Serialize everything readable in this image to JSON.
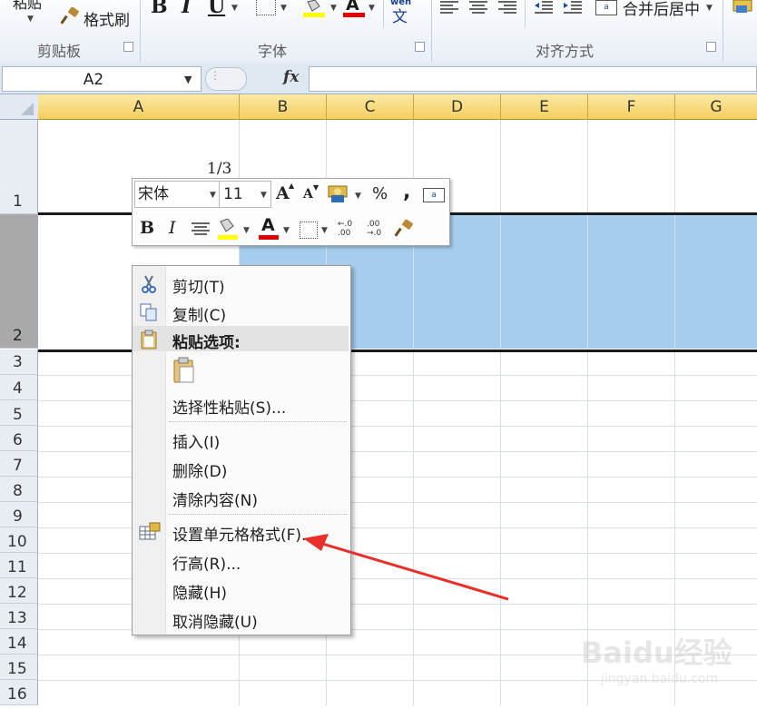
{
  "ribbon": {
    "paste_label": "粘贴",
    "format_painter_label": "格式刷",
    "bold": "B",
    "italic": "I",
    "underline": "U",
    "font_color_glyph": "A",
    "phonetic_glyph": "wén",
    "merge_center_label": "合并后居中",
    "groups": {
      "clipboard": "剪贴板",
      "font": "字体",
      "alignment": "对齐方式"
    }
  },
  "formula_bar": {
    "name_box": "A2",
    "fx_label": "fx",
    "formula": ""
  },
  "grid": {
    "columns": [
      "A",
      "B",
      "C",
      "D",
      "E",
      "F",
      "G"
    ],
    "rows": [
      "1",
      "2",
      "3",
      "4",
      "5",
      "6",
      "7",
      "8",
      "9",
      "10",
      "11",
      "12",
      "13",
      "14",
      "15",
      "16"
    ],
    "selected_row": "2",
    "selection_color": "#a6cdee",
    "cells": {
      "A1": "1/3"
    }
  },
  "mini_toolbar": {
    "font_name": "宋体",
    "font_size": "11",
    "grow_font": "A",
    "shrink_font": "A",
    "percent": "%",
    "comma": ",",
    "bold": "B",
    "italic": "I",
    "font_color_glyph": "A",
    "font_color": "#e00000",
    "fill_color": "#ffff00"
  },
  "context_menu": {
    "cut": "剪切(T)",
    "copy": "复制(C)",
    "paste_options_header": "粘贴选项:",
    "paste_special": "选择性粘贴(S)...",
    "insert": "插入(I)",
    "delete": "删除(D)",
    "clear_contents": "清除内容(N)",
    "format_cells": "设置单元格格式(F)...",
    "row_height": "行高(R)...",
    "hide": "隐藏(H)",
    "unhide": "取消隐藏(U)"
  },
  "annotation": {
    "arrow_color": "#e8302a"
  },
  "watermark": {
    "logo": "Baidu经验",
    "url": "jingyan.baidu.com"
  }
}
